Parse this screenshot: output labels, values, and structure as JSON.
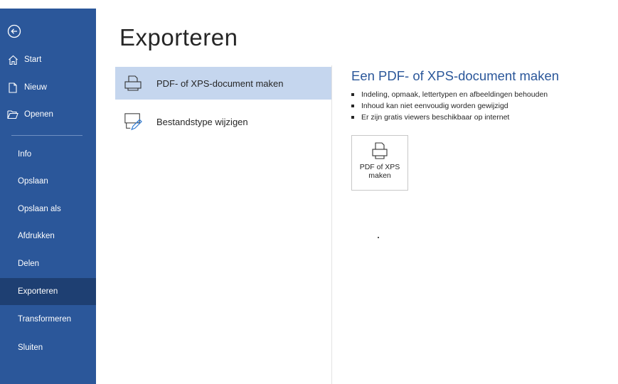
{
  "sidebar": {
    "back_icon": "back-arrow-circle-icon",
    "top_items": [
      {
        "label": "Start",
        "icon": "home-icon"
      },
      {
        "label": "Nieuw",
        "icon": "new-document-icon"
      },
      {
        "label": "Openen",
        "icon": "folder-open-icon"
      }
    ],
    "items": [
      {
        "label": "Info"
      },
      {
        "label": "Opslaan"
      },
      {
        "label": "Opslaan als"
      },
      {
        "label": "Afdrukken"
      },
      {
        "label": "Delen"
      },
      {
        "label": "Exporteren",
        "active": true
      },
      {
        "label": "Transformeren"
      },
      {
        "label": "Sluiten"
      }
    ],
    "colors": {
      "background": "#2b579a",
      "active": "#1e3f72"
    }
  },
  "main": {
    "title": "Exporteren",
    "options": [
      {
        "label": "PDF- of XPS-document maken",
        "icon": "pdf-printer-icon",
        "selected": true
      },
      {
        "label": "Bestandstype wijzigen",
        "icon": "change-filetype-icon",
        "selected": false
      }
    ]
  },
  "detail": {
    "title": "Een PDF- of XPS-document maken",
    "bullets": [
      "Indeling, opmaak, lettertypen en afbeeldingen behouden",
      "Inhoud kan niet eenvoudig worden gewijzigd",
      "Er zijn gratis viewers beschikbaar op internet"
    ],
    "button_line1": "PDF of XPS",
    "button_line2": "maken",
    "button_icon": "pdf-document-icon",
    "accent": "#2b579a"
  }
}
